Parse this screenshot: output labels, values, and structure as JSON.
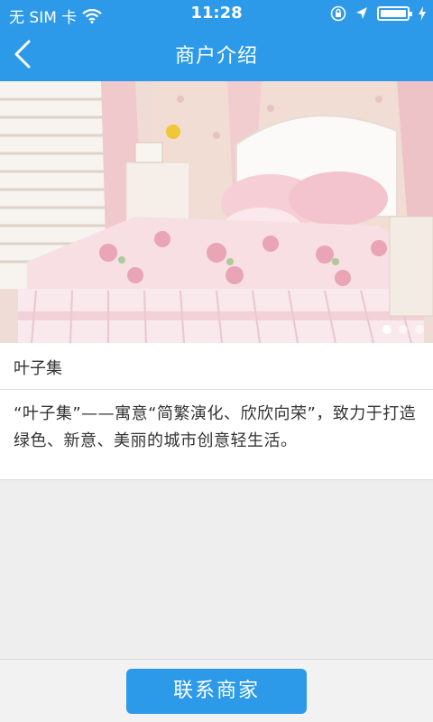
{
  "status_bar": {
    "carrier": "无 SIM 卡",
    "time": "11:28",
    "battery_level": 1.0,
    "icons": [
      "wifi-icon",
      "orientation-lock-icon",
      "location-icon",
      "battery-icon",
      "charging-icon"
    ]
  },
  "nav": {
    "title": "商户介绍",
    "back_icon": "chevron-left-icon"
  },
  "gallery": {
    "image": "bedroom-bed-photo",
    "page_count": 3,
    "active_index": 0
  },
  "merchant": {
    "name": "叶子集",
    "description": "“叶子集”——寓意“简繁演化、欣欣向荣”，致力于打造绿色、新意、美丽的城市创意轻生活。"
  },
  "footer": {
    "contact_label": "联系商家"
  },
  "colors": {
    "primary": "#2c9ae8",
    "background": "#eeeeee"
  }
}
